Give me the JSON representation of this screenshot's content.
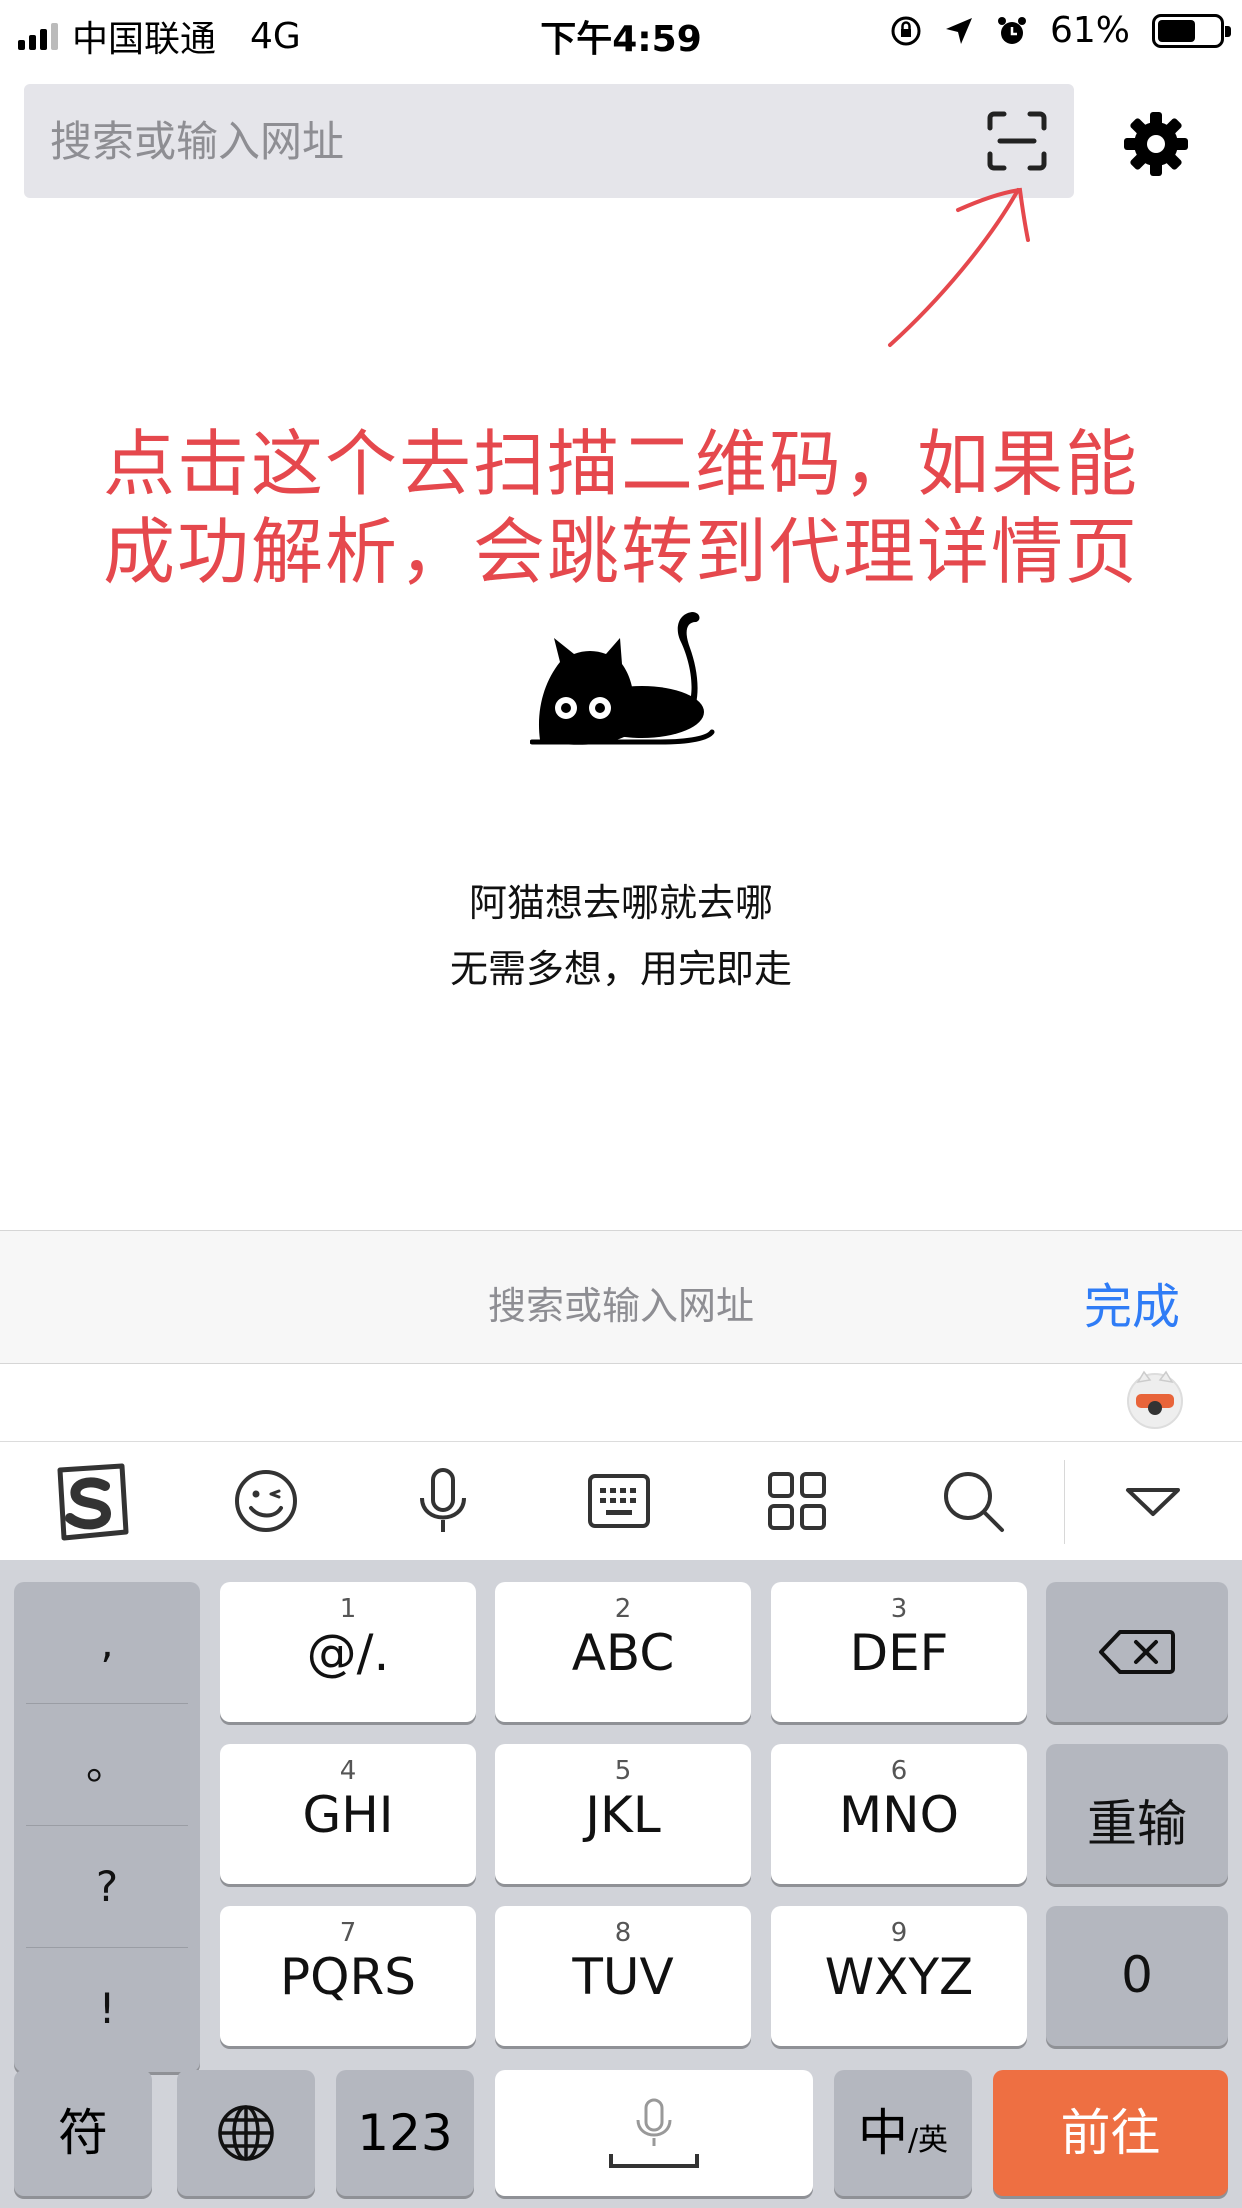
{
  "status_bar": {
    "carrier": "中国联通",
    "network": "4G",
    "time": "下午4:59",
    "battery_percent": "61%",
    "battery_level": 0.61,
    "signal_bars": 3
  },
  "url_bar": {
    "placeholder": "搜索或输入网址",
    "scan_icon": "scan-qr-icon",
    "settings_icon": "gear-icon"
  },
  "annotation": {
    "line1": "点击这个去扫描二维码，如果能",
    "line2": "成功解析，会跳转到代理详情页",
    "color": "#e5484d"
  },
  "tagline": {
    "line1": "阿猫想去哪就去哪",
    "line2": "无需多想，用完即走"
  },
  "input_accessory": {
    "placeholder": "搜索或输入网址",
    "done_label": "完成",
    "done_color": "#2f7cf6"
  },
  "ime_toolbar": {
    "icons": [
      "sogou-logo-icon",
      "emoji-icon",
      "microphone-icon",
      "keyboard-icon",
      "apps-grid-icon",
      "search-icon",
      "collapse-keyboard-icon"
    ]
  },
  "keyboard": {
    "punctuation": [
      ",",
      "。",
      "?",
      "!"
    ],
    "keys": [
      {
        "num": "1",
        "label": "@/."
      },
      {
        "num": "2",
        "label": "ABC"
      },
      {
        "num": "3",
        "label": "DEF"
      },
      {
        "num": "4",
        "label": "GHI"
      },
      {
        "num": "5",
        "label": "JKL"
      },
      {
        "num": "6",
        "label": "MNO"
      },
      {
        "num": "7",
        "label": "PQRS"
      },
      {
        "num": "8",
        "label": "TUV"
      },
      {
        "num": "9",
        "label": "WXYZ"
      }
    ],
    "retype_label": "重输",
    "zero_label": "0",
    "symbols_label": "符",
    "numbers_label": "123",
    "lang_label_main": "中",
    "lang_label_sub": "/英",
    "go_label": "前往",
    "go_color": "#ee6f42"
  }
}
